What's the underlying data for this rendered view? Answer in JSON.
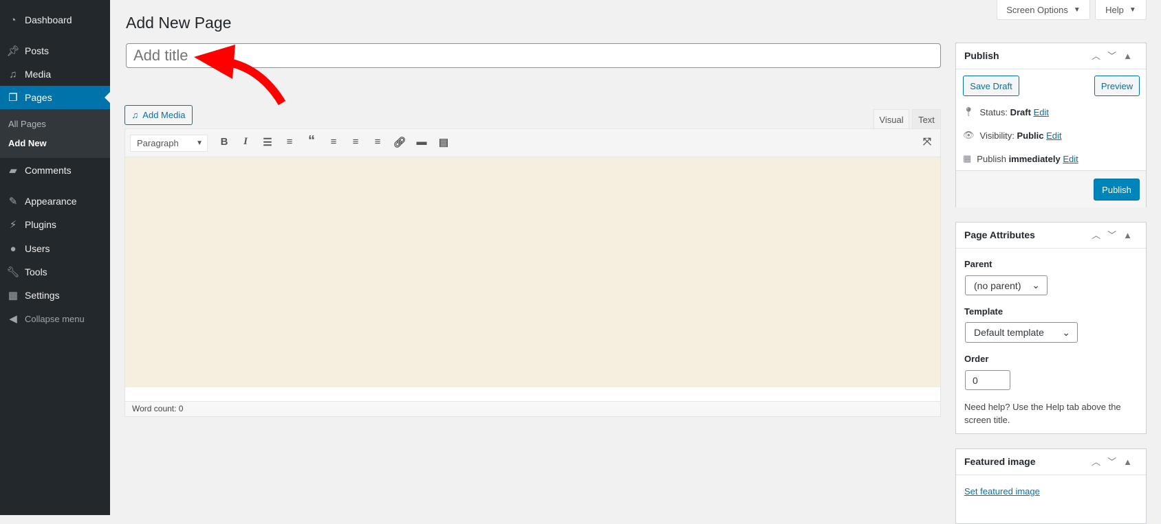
{
  "sidebar": {
    "items": [
      {
        "label": "Dashboard",
        "icon": "dashboard-icon"
      },
      {
        "label": "Posts",
        "icon": "pin-icon"
      },
      {
        "label": "Media",
        "icon": "media-icon"
      },
      {
        "label": "Pages",
        "icon": "pages-icon",
        "active": true
      },
      {
        "label": "Comments",
        "icon": "comment-icon"
      },
      {
        "label": "Appearance",
        "icon": "brush-icon"
      },
      {
        "label": "Plugins",
        "icon": "plugin-icon"
      },
      {
        "label": "Users",
        "icon": "user-icon"
      },
      {
        "label": "Tools",
        "icon": "wrench-icon"
      },
      {
        "label": "Settings",
        "icon": "settings-icon"
      },
      {
        "label": "Collapse menu",
        "icon": "collapse-icon"
      }
    ],
    "submenu": [
      "All Pages",
      "Add New"
    ]
  },
  "header": {
    "screen_options": "Screen Options",
    "help": "Help",
    "title": "Add New Page"
  },
  "title_input": {
    "placeholder": "Add title",
    "value": ""
  },
  "editor": {
    "add_media": "Add Media",
    "tab_visual": "Visual",
    "tab_text": "Text",
    "format": "Paragraph",
    "word_count": "Word count: 0",
    "toolbar": [
      "bold",
      "italic",
      "bullet-list",
      "numbered-list",
      "blockquote",
      "align-left",
      "align-center",
      "align-right",
      "link",
      "read-more",
      "toolbar-toggle",
      "fullscreen"
    ]
  },
  "publish": {
    "title": "Publish",
    "save_draft": "Save Draft",
    "preview": "Preview",
    "status_label": "Status:",
    "status_value": "Draft",
    "visibility_label": "Visibility:",
    "visibility_value": "Public",
    "schedule_label": "Publish",
    "schedule_value": "immediately",
    "edit": "Edit",
    "publish_button": "Publish"
  },
  "attributes": {
    "title": "Page Attributes",
    "parent_label": "Parent",
    "parent_value": "(no parent)",
    "template_label": "Template",
    "template_value": "Default template",
    "order_label": "Order",
    "order_value": "0",
    "help": "Need help? Use the Help tab above the screen title."
  },
  "featured": {
    "title": "Featured image",
    "link": "Set featured image"
  },
  "colors": {
    "accent": "#0073aa",
    "sidebar": "#23282d",
    "arrow": "#ff0000",
    "editor_bg": "#f5efe0"
  }
}
